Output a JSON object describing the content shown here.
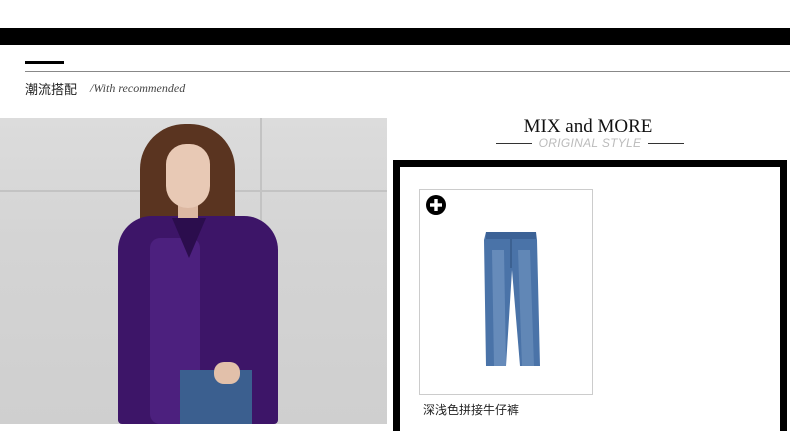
{
  "section": {
    "title": "潮流搭配",
    "subtitle": "/With recommended"
  },
  "mix": {
    "title": "MIX and MORE",
    "subtitle": "ORIGINAL STYLE"
  },
  "product": {
    "name": "深浅色拼接牛仔裤",
    "add_icon": "plus-circle-icon"
  },
  "colors": {
    "bar": "#000000",
    "shirt": "#3d1568",
    "denim": "#4a73a8"
  }
}
